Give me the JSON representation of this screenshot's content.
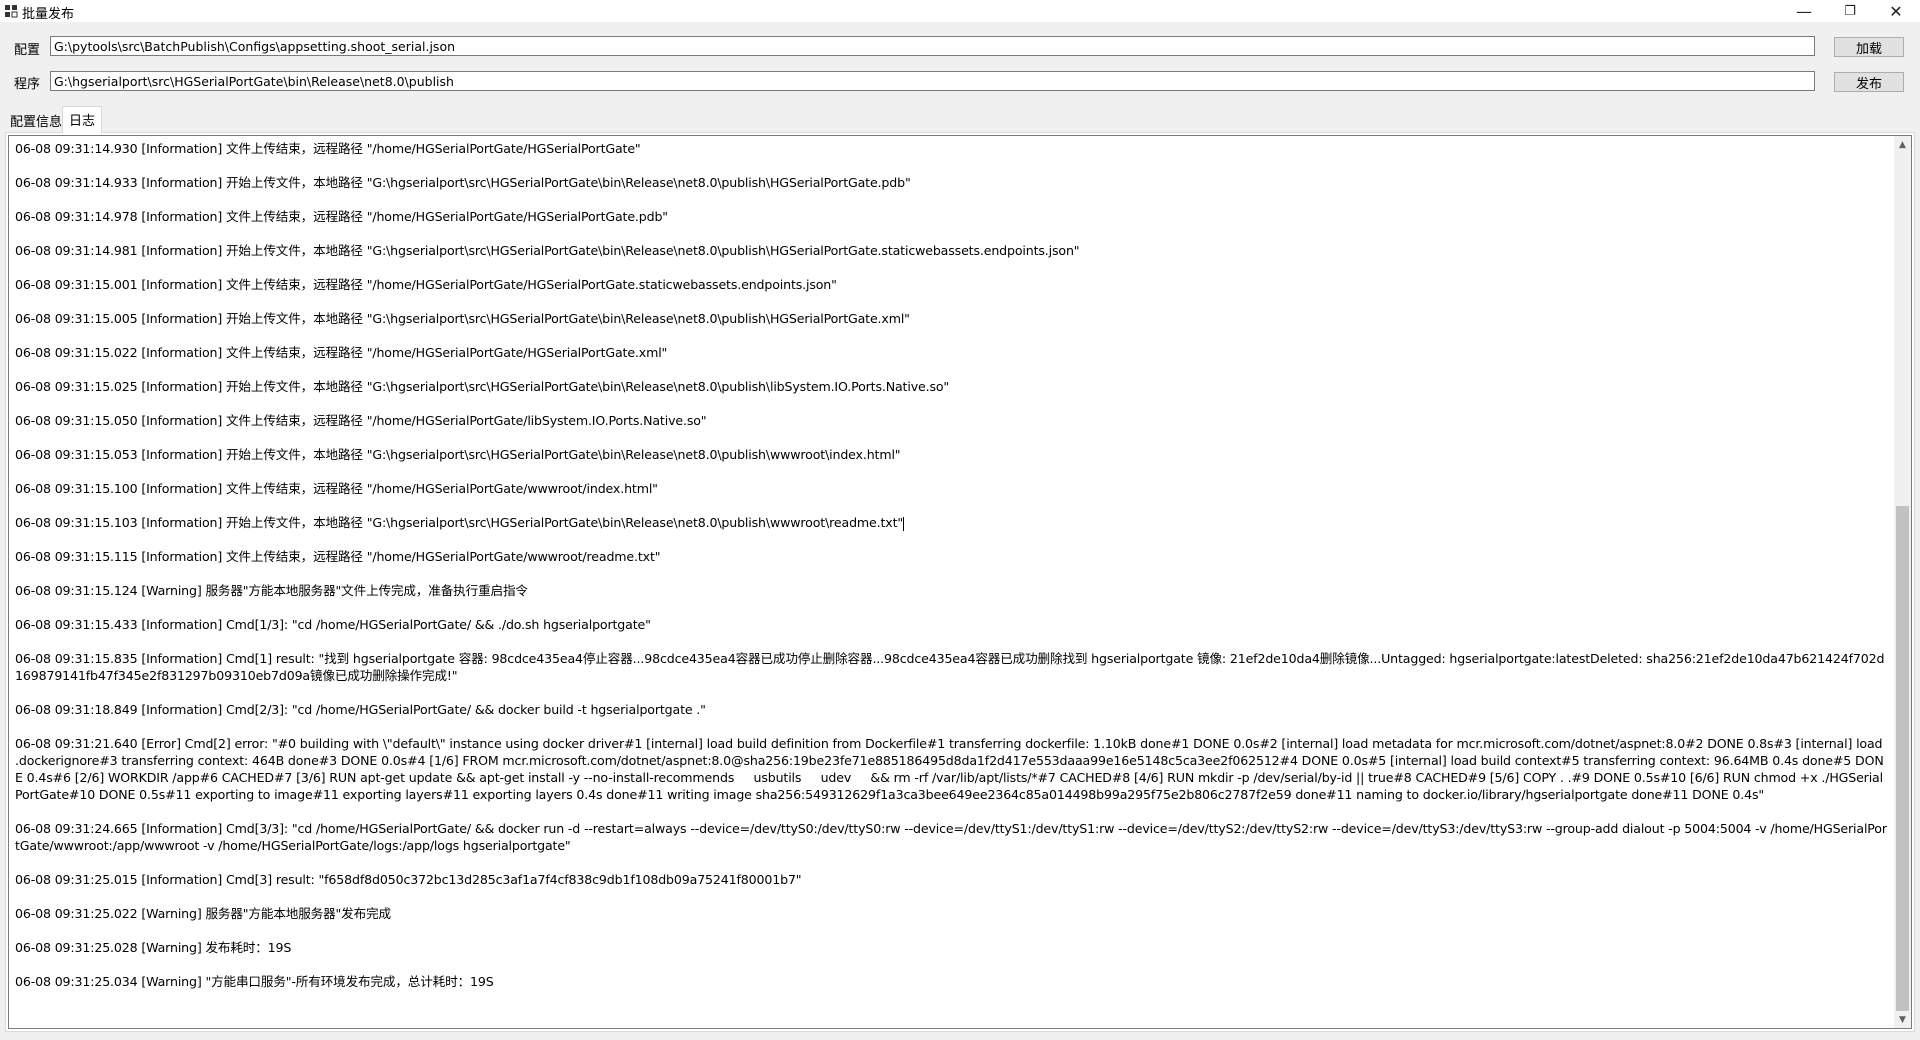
{
  "window": {
    "title": "批量发布",
    "minimize_glyph": "—",
    "restore_glyph": "❐",
    "close_glyph": "✕",
    "app_icon": "app-grid-icon"
  },
  "config_row": {
    "label": "配置",
    "value": "G:\\pytools\\src\\BatchPublish\\Configs\\appsetting.shoot_serial.json",
    "button": "加载"
  },
  "program_row": {
    "label": "程序",
    "value": "G:\\hgserialport\\src\\HGSerialPortGate\\bin\\Release\\net8.0\\publish",
    "button": "发布"
  },
  "tabs": [
    {
      "label": "配置信息",
      "active": false
    },
    {
      "label": "日志",
      "active": true
    }
  ],
  "scrollbar": {
    "up_glyph": "▲",
    "down_glyph": "▼",
    "position_fraction": 1.0
  },
  "log": [
    "06-08 09:31:14.930 [Information] 文件上传结束，远程路径 \"/home/HGSerialPortGate/HGSerialPortGate\"",
    "06-08 09:31:14.933 [Information] 开始上传文件，本地路径 \"G:\\hgserialport\\src\\HGSerialPortGate\\bin\\Release\\net8.0\\publish\\HGSerialPortGate.pdb\"",
    "06-08 09:31:14.978 [Information] 文件上传结束，远程路径 \"/home/HGSerialPortGate/HGSerialPortGate.pdb\"",
    "06-08 09:31:14.981 [Information] 开始上传文件，本地路径 \"G:\\hgserialport\\src\\HGSerialPortGate\\bin\\Release\\net8.0\\publish\\HGSerialPortGate.staticwebassets.endpoints.json\"",
    "06-08 09:31:15.001 [Information] 文件上传结束，远程路径 \"/home/HGSerialPortGate/HGSerialPortGate.staticwebassets.endpoints.json\"",
    "06-08 09:31:15.005 [Information] 开始上传文件，本地路径 \"G:\\hgserialport\\src\\HGSerialPortGate\\bin\\Release\\net8.0\\publish\\HGSerialPortGate.xml\"",
    "06-08 09:31:15.022 [Information] 文件上传结束，远程路径 \"/home/HGSerialPortGate/HGSerialPortGate.xml\"",
    "06-08 09:31:15.025 [Information] 开始上传文件，本地路径 \"G:\\hgserialport\\src\\HGSerialPortGate\\bin\\Release\\net8.0\\publish\\libSystem.IO.Ports.Native.so\"",
    "06-08 09:31:15.050 [Information] 文件上传结束，远程路径 \"/home/HGSerialPortGate/libSystem.IO.Ports.Native.so\"",
    "06-08 09:31:15.053 [Information] 开始上传文件，本地路径 \"G:\\hgserialport\\src\\HGSerialPortGate\\bin\\Release\\net8.0\\publish\\wwwroot\\index.html\"",
    "06-08 09:31:15.100 [Information] 文件上传结束，远程路径 \"/home/HGSerialPortGate/wwwroot/index.html\"",
    "06-08 09:31:15.103 [Information] 开始上传文件，本地路径 \"G:\\hgserialport\\src\\HGSerialPortGate\\bin\\Release\\net8.0\\publish\\wwwroot\\readme.txt\"",
    "06-08 09:31:15.115 [Information] 文件上传结束，远程路径 \"/home/HGSerialPortGate/wwwroot/readme.txt\"",
    "06-08 09:31:15.124 [Warning] 服务器\"方能本地服务器\"文件上传完成，准备执行重启指令",
    "06-08 09:31:15.433 [Information] Cmd[1/3]: \"cd /home/HGSerialPortGate/ && ./do.sh hgserialportgate\"",
    "06-08 09:31:15.835 [Information] Cmd[1] result: \"找到 hgserialportgate 容器: 98cdce435ea4停止容器...98cdce435ea4容器已成功停止删除容器...98cdce435ea4容器已成功删除找到 hgserialportgate 镜像: 21ef2de10da4删除镜像...Untagged: hgserialportgate:latestDeleted: sha256:21ef2de10da47b621424f702d169879141fb47f345e2f831297b09310eb7d09a镜像已成功删除操作完成!\"",
    "06-08 09:31:18.849 [Information] Cmd[2/3]: \"cd /home/HGSerialPortGate/ && docker build -t hgserialportgate .\"",
    "06-08 09:31:21.640 [Error] Cmd[2] error: \"#0 building with \\\"default\\\" instance using docker driver#1 [internal] load build definition from Dockerfile#1 transferring dockerfile: 1.10kB done#1 DONE 0.0s#2 [internal] load metadata for mcr.microsoft.com/dotnet/aspnet:8.0#2 DONE 0.8s#3 [internal] load .dockerignore#3 transferring context: 464B done#3 DONE 0.0s#4 [1/6] FROM mcr.microsoft.com/dotnet/aspnet:8.0@sha256:19be23fe71e885186495d8da1f2d417e553daaa99e16e5148c5ca3ee2f062512#4 DONE 0.0s#5 [internal] load build context#5 transferring context: 96.64MB 0.4s done#5 DONE 0.4s#6 [2/6] WORKDIR /app#6 CACHED#7 [3/6] RUN apt-get update && apt-get install -y --no-install-recommends     usbutils     udev     && rm -rf /var/lib/apt/lists/*#7 CACHED#8 [4/6] RUN mkdir -p /dev/serial/by-id || true#8 CACHED#9 [5/6] COPY . .#9 DONE 0.5s#10 [6/6] RUN chmod +x ./HGSerialPortGate#10 DONE 0.5s#11 exporting to image#11 exporting layers#11 exporting layers 0.4s done#11 writing image sha256:549312629f1a3ca3bee649ee2364c85a014498b99a295f75e2b806c2787f2e59 done#11 naming to docker.io/library/hgserialportgate done#11 DONE 0.4s\"",
    "06-08 09:31:24.665 [Information] Cmd[3/3]: \"cd /home/HGSerialPortGate/ && docker run -d --restart=always --device=/dev/ttyS0:/dev/ttyS0:rw --device=/dev/ttyS1:/dev/ttyS1:rw --device=/dev/ttyS2:/dev/ttyS2:rw --device=/dev/ttyS3:/dev/ttyS3:rw --group-add dialout -p 5004:5004 -v /home/HGSerialPortGate/wwwroot:/app/wwwroot -v /home/HGSerialPortGate/logs:/app/logs hgserialportgate\"",
    "06-08 09:31:25.015 [Information] Cmd[3] result: \"f658df8d050c372bc13d285c3af1a7f4cf838c9db1f108db09a75241f80001b7\"",
    "06-08 09:31:25.022 [Warning] 服务器\"方能本地服务器\"发布完成",
    "06-08 09:31:25.028 [Warning] 发布耗时：19S",
    "06-08 09:31:25.034 [Warning] \"方能串口服务\"-所有环境发布完成，总计耗时：19S"
  ]
}
